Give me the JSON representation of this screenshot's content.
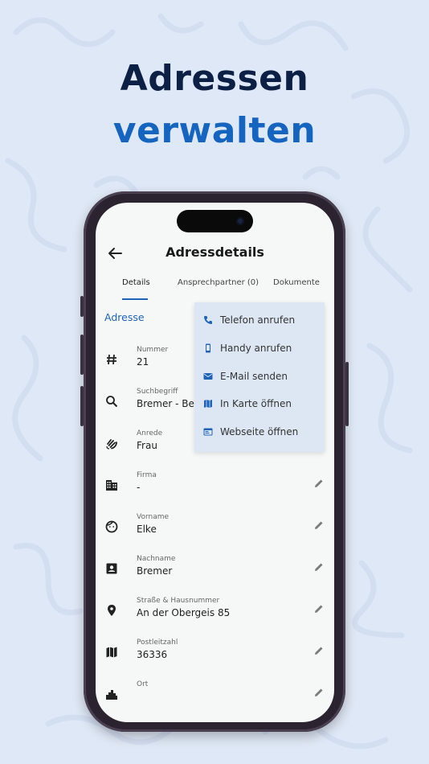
{
  "marketing": {
    "line1": "Adressen",
    "line2": "verwalten"
  },
  "appbar": {
    "title": "Adressdetails"
  },
  "tabs": [
    {
      "label": "Details",
      "active": true
    },
    {
      "label": "Ansprechpartner (0)"
    },
    {
      "label": "Dokumente"
    }
  ],
  "section_title": "Adresse",
  "fields": [
    {
      "label": "Nummer",
      "value": "21",
      "icon": "hash-icon"
    },
    {
      "label": "Suchbegriff",
      "value": "Bremer - Bei",
      "icon": "search-icon"
    },
    {
      "label": "Anrede",
      "value": "Frau",
      "icon": "wave-hand-icon"
    },
    {
      "label": "Firma",
      "value": "-",
      "icon": "building-icon"
    },
    {
      "label": "Vorname",
      "value": "Elke",
      "icon": "face-icon"
    },
    {
      "label": "Nachname",
      "value": "Bremer",
      "icon": "contact-card-icon"
    },
    {
      "label": "Straße & Hausnummer",
      "value": "An der Obergeis 85",
      "icon": "location-pin-icon"
    },
    {
      "label": "Postleitzahl",
      "value": "36336",
      "icon": "map-icon"
    },
    {
      "label": "Ort",
      "value": "",
      "icon": "city-icon"
    }
  ],
  "menu": [
    {
      "label": "Telefon anrufen",
      "icon": "phone-icon"
    },
    {
      "label": "Handy anrufen",
      "icon": "mobile-icon"
    },
    {
      "label": "E-Mail senden",
      "icon": "email-icon"
    },
    {
      "label": "In Karte öffnen",
      "icon": "map-icon"
    },
    {
      "label": "Webseite öffnen",
      "icon": "web-icon"
    }
  ],
  "colors": {
    "accent": "#1e63b8",
    "headline_dark": "#0c1f44",
    "headline_blue": "#1565c0",
    "background": "#dfe8f6",
    "menu_bg": "#dce7f3"
  }
}
